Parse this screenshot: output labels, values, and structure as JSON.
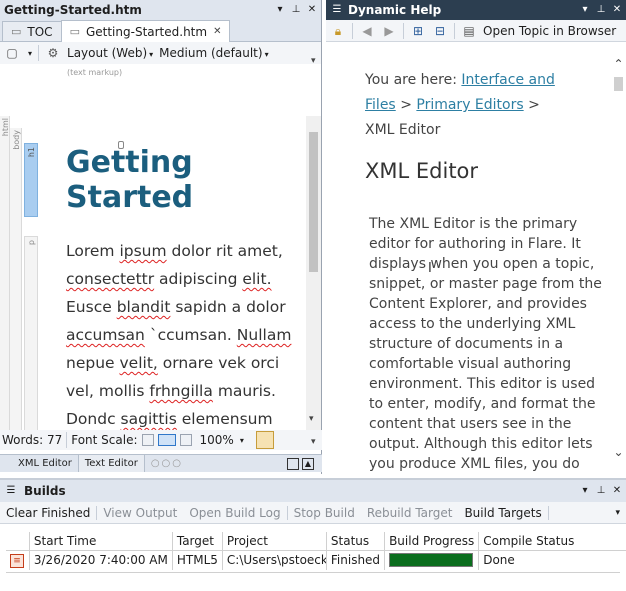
{
  "left_pane": {
    "title": "Getting-Started.htm",
    "tabs": [
      {
        "label": "TOC",
        "active": false
      },
      {
        "label": "Getting-Started.htm",
        "active": true
      }
    ],
    "toolbar": {
      "layout_label": "Layout (Web)",
      "medium_label": "Medium (default)",
      "markup_hint": "(text markup)"
    },
    "structure_labels": {
      "html": "html",
      "body": "body",
      "h1": "h1",
      "p": "p"
    },
    "document": {
      "heading": "Getting Started",
      "para_lines": [
        "Lorem ipsum dolor rit amet,",
        "consectettr adipiscing elit.",
        "Eusce blandit sapidn a dolor",
        "accumsan `ccumsan. Nullam",
        "nepue velit, ornare vek orci",
        "vel, mollis frhngilla mauris.",
        "Dondc sagittis elemensum"
      ]
    },
    "status": {
      "words_label": "Words: 77",
      "font_scale_label": "Font Scale:",
      "zoom": "100%"
    },
    "bottom_tabs": [
      {
        "label": "XML Editor",
        "active": true
      },
      {
        "label": "Text Editor",
        "active": false
      }
    ]
  },
  "help_pane": {
    "title": "Dynamic Help",
    "open_topic_label": "Open Topic in Browser",
    "breadcrumb_prefix": "You are here:",
    "crumb1": "Interface and Files",
    "crumb1_line1": "Interface and",
    "crumb1_line2": "Files",
    "sep": ">",
    "crumb2": "Primary Editors",
    "crumb3": "XML Editor",
    "heading": "XML Editor",
    "body_lines": [
      "The XML Editor is the primary",
      "editor for authoring in Flare. It",
      "displays when you open a topic,",
      "snippet, or master page from the",
      "Content Explorer, and provides",
      "access to the underlying XML",
      "structure of documents in a",
      "comfortable visual authoring",
      "environment. This editor is used",
      "to enter, modify, and format the",
      "content that users see in the",
      "output. Although this editor lets",
      "you produce XML files, you do"
    ]
  },
  "builds": {
    "title": "Builds",
    "toolbar": [
      {
        "label": "Clear Finished",
        "enabled": true
      },
      {
        "label": "View Output",
        "enabled": false
      },
      {
        "label": "Open Build Log",
        "enabled": false
      },
      {
        "label": "Stop Build",
        "enabled": false
      },
      {
        "label": "Rebuild Target",
        "enabled": false
      },
      {
        "label": "Build Targets",
        "enabled": true
      }
    ],
    "columns": [
      "Start Time",
      "Target",
      "Project",
      "Status",
      "Build Progress",
      "Compile Status"
    ],
    "rows": [
      {
        "start_time": "3/26/2020 7:40:00 AM",
        "target": "HTML5",
        "project": "C:\\Users\\pstoeckle",
        "status": "Finished",
        "progress": 1.0,
        "compile_status": "Done"
      }
    ]
  },
  "colors": {
    "dark_title": "#2c3e50",
    "heading": "#1b5e7e",
    "link": "#2d7fa3",
    "progress": "#0b6e1e"
  }
}
